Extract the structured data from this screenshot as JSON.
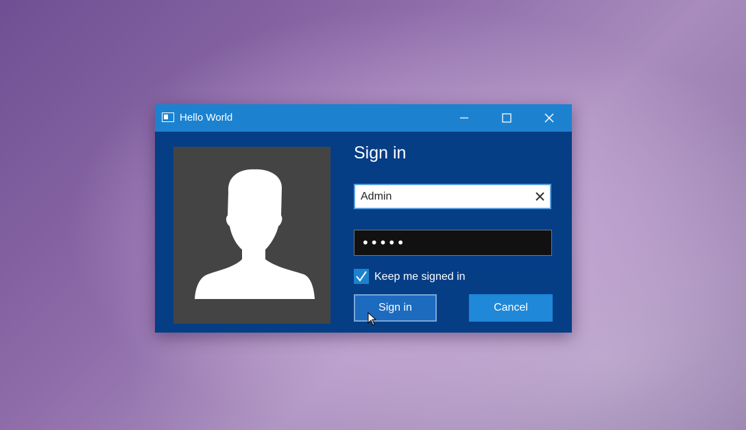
{
  "window": {
    "title": "Hello World",
    "accent": "#1c82d0",
    "background": "#063e86"
  },
  "controls": {
    "minimize_icon": "minimize-icon",
    "maximize_icon": "maximize-icon",
    "close_icon": "close-icon"
  },
  "avatar": {
    "icon": "user-silhouette-icon"
  },
  "form": {
    "heading": "Sign in",
    "username_value": "Admin",
    "clear_icon": "clear-x-icon",
    "password_value": "•••••",
    "keep_signed_in_label": "Keep me signed in",
    "keep_signed_in_checked": true,
    "signin_label": "Sign in",
    "cancel_label": "Cancel"
  }
}
